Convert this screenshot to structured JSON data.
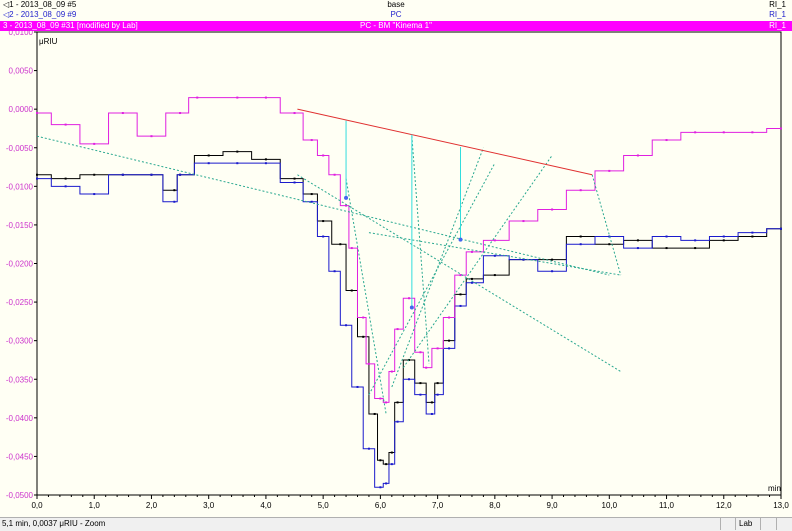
{
  "legend": {
    "row1": {
      "label": "1 - 2013_08_09 #5",
      "center": "base",
      "right": "RI_1",
      "marker": "◁"
    },
    "row2": {
      "label": "2 - 2013_08_09 #9",
      "center": "PC",
      "right": "RI_1",
      "marker": "◁"
    },
    "row3": {
      "label": "3 - 2013_08_09 #31 [modified by Lab]",
      "center": "PC - BM \"Kinema 1\"",
      "right": "RI_1"
    }
  },
  "colors": {
    "series1": "#000000",
    "series2": "#1a1acc",
    "series3": "#e020e0",
    "baseline": "#e03030",
    "tangent": "#2aa890",
    "marker": "#33dddd",
    "background": "#fffff4"
  },
  "chart_data": {
    "type": "line",
    "ylabel": "μRIU",
    "xlabel": "min",
    "xlim": [
      0,
      13
    ],
    "ylim": [
      -0.05,
      0.01
    ],
    "x_ticks": [
      "0,0",
      "1,0",
      "2,0",
      "3,0",
      "4,0",
      "5,0",
      "6,0",
      "7,0",
      "8,0",
      "9,0",
      "10,0",
      "11,0",
      "12,0",
      "13,0"
    ],
    "y_ticks": [
      "0,0100",
      "0,0050",
      "0,0000",
      "-0,0050",
      "-0,0100",
      "-0,0150",
      "-0,0200",
      "-0,0250",
      "-0,0300",
      "-0,0350",
      "-0,0400",
      "-0,0450",
      "-0,0500"
    ],
    "series": [
      {
        "name": "1 - 2013_08_09 #5",
        "color": "#000000",
        "x": [
          0,
          0.5,
          1,
          1.5,
          2,
          2.4,
          2.5,
          3,
          3.5,
          4,
          4.5,
          4.8,
          5,
          5.3,
          5.5,
          5.7,
          5.9,
          6.0,
          6.1,
          6.2,
          6.3,
          6.5,
          6.7,
          6.9,
          7.0,
          7.2,
          7.4,
          7.6,
          8,
          8.5,
          9,
          9.5,
          10,
          10.5,
          11,
          11.5,
          12,
          12.5,
          13
        ],
        "y": [
          -0.0085,
          -0.009,
          -0.0085,
          -0.0085,
          -0.0085,
          -0.0105,
          -0.0085,
          -0.006,
          -0.0055,
          -0.0065,
          -0.009,
          -0.011,
          -0.0145,
          -0.0175,
          -0.0235,
          -0.0295,
          -0.0395,
          -0.0455,
          -0.046,
          -0.0445,
          -0.038,
          -0.0325,
          -0.0355,
          -0.038,
          -0.0355,
          -0.03,
          -0.024,
          -0.022,
          -0.0215,
          -0.0195,
          -0.0195,
          -0.0165,
          -0.0175,
          -0.017,
          -0.018,
          -0.018,
          -0.017,
          -0.0165,
          -0.0155
        ]
      },
      {
        "name": "2 - 2013_08_09 #9",
        "color": "#1a1acc",
        "x": [
          0,
          0.5,
          1,
          1.5,
          2,
          2.4,
          2.5,
          3,
          3.5,
          4,
          4.5,
          4.8,
          5,
          5.2,
          5.4,
          5.6,
          5.8,
          6.0,
          6.1,
          6.2,
          6.3,
          6.5,
          6.7,
          6.9,
          7.0,
          7.2,
          7.4,
          7.6,
          8,
          8.5,
          9,
          9.5,
          10,
          10.5,
          11,
          11.5,
          12,
          12.5,
          13
        ],
        "y": [
          -0.009,
          -0.01,
          -0.011,
          -0.0085,
          -0.0085,
          -0.012,
          -0.0085,
          -0.007,
          -0.007,
          -0.007,
          -0.0095,
          -0.012,
          -0.0165,
          -0.021,
          -0.028,
          -0.036,
          -0.044,
          -0.049,
          -0.0485,
          -0.046,
          -0.0405,
          -0.035,
          -0.037,
          -0.0395,
          -0.037,
          -0.031,
          -0.0255,
          -0.0225,
          -0.019,
          -0.0195,
          -0.021,
          -0.0175,
          -0.0165,
          -0.018,
          -0.0165,
          -0.017,
          -0.0165,
          -0.016,
          -0.0155
        ]
      },
      {
        "name": "3 - 2013_08_09 #31 [modified by Lab]",
        "color": "#e020e0",
        "x": [
          0,
          0.5,
          1,
          1.5,
          2,
          2.5,
          2.8,
          3.5,
          4,
          4.5,
          4.8,
          5.0,
          5.2,
          5.4,
          5.5,
          5.7,
          5.8,
          6.0,
          6.1,
          6.2,
          6.3,
          6.5,
          6.7,
          6.8,
          7.0,
          7.2,
          7.4,
          7.6,
          8,
          8.5,
          9,
          9.5,
          10,
          10.5,
          11,
          11.5,
          12,
          12.5,
          13
        ],
        "y": [
          -0.0005,
          -0.002,
          -0.0045,
          -0.0005,
          -0.0035,
          -0.0005,
          0.0015,
          0.0015,
          0.0015,
          -0.0005,
          -0.004,
          -0.006,
          -0.0085,
          -0.0125,
          -0.018,
          -0.027,
          -0.033,
          -0.0375,
          -0.038,
          -0.034,
          -0.0285,
          -0.0245,
          -0.0315,
          -0.0335,
          -0.031,
          -0.027,
          -0.0215,
          -0.0185,
          -0.017,
          -0.0145,
          -0.013,
          -0.0105,
          -0.008,
          -0.006,
          -0.004,
          -0.003,
          -0.003,
          -0.003,
          -0.0025
        ]
      }
    ],
    "annotations": {
      "baseline": {
        "x": [
          4.55,
          9.7
        ],
        "y": [
          0.0,
          -0.0085
        ]
      },
      "markers": [
        {
          "x": 5.4,
          "y_top": -0.0015,
          "y_bottom": -0.0115
        },
        {
          "x": 6.55,
          "y_top": -0.0033,
          "y_bottom": -0.0257
        },
        {
          "x": 7.4,
          "y_top": -0.0049,
          "y_bottom": -0.0169
        }
      ],
      "tangents": [
        {
          "x": [
            0,
            10
          ],
          "y": [
            -0.0035,
            -0.0215
          ]
        },
        {
          "x": [
            5.4,
            6.1
          ],
          "y": [
            -0.009,
            -0.0395
          ]
        },
        {
          "x": [
            6.55,
            6.85
          ],
          "y": [
            -0.0035,
            -0.033
          ]
        },
        {
          "x": [
            6.2,
            7.8
          ],
          "y": [
            -0.036,
            -0.005
          ]
        },
        {
          "x": [
            5.8,
            8.0
          ],
          "y": [
            -0.037,
            -0.007
          ]
        },
        {
          "x": [
            6.4,
            9.0
          ],
          "y": [
            -0.0335,
            -0.006
          ]
        },
        {
          "x": [
            5.8,
            10.2
          ],
          "y": [
            -0.016,
            -0.0215
          ]
        },
        {
          "x": [
            9.7,
            10.2
          ],
          "y": [
            -0.0085,
            -0.0215
          ]
        },
        {
          "x": [
            4.55,
            10.2
          ],
          "y": [
            -0.0085,
            -0.034
          ]
        }
      ]
    }
  },
  "status": {
    "text": "5,1 min, 0,0037 μRIU - Zoom",
    "user": "Lab"
  }
}
